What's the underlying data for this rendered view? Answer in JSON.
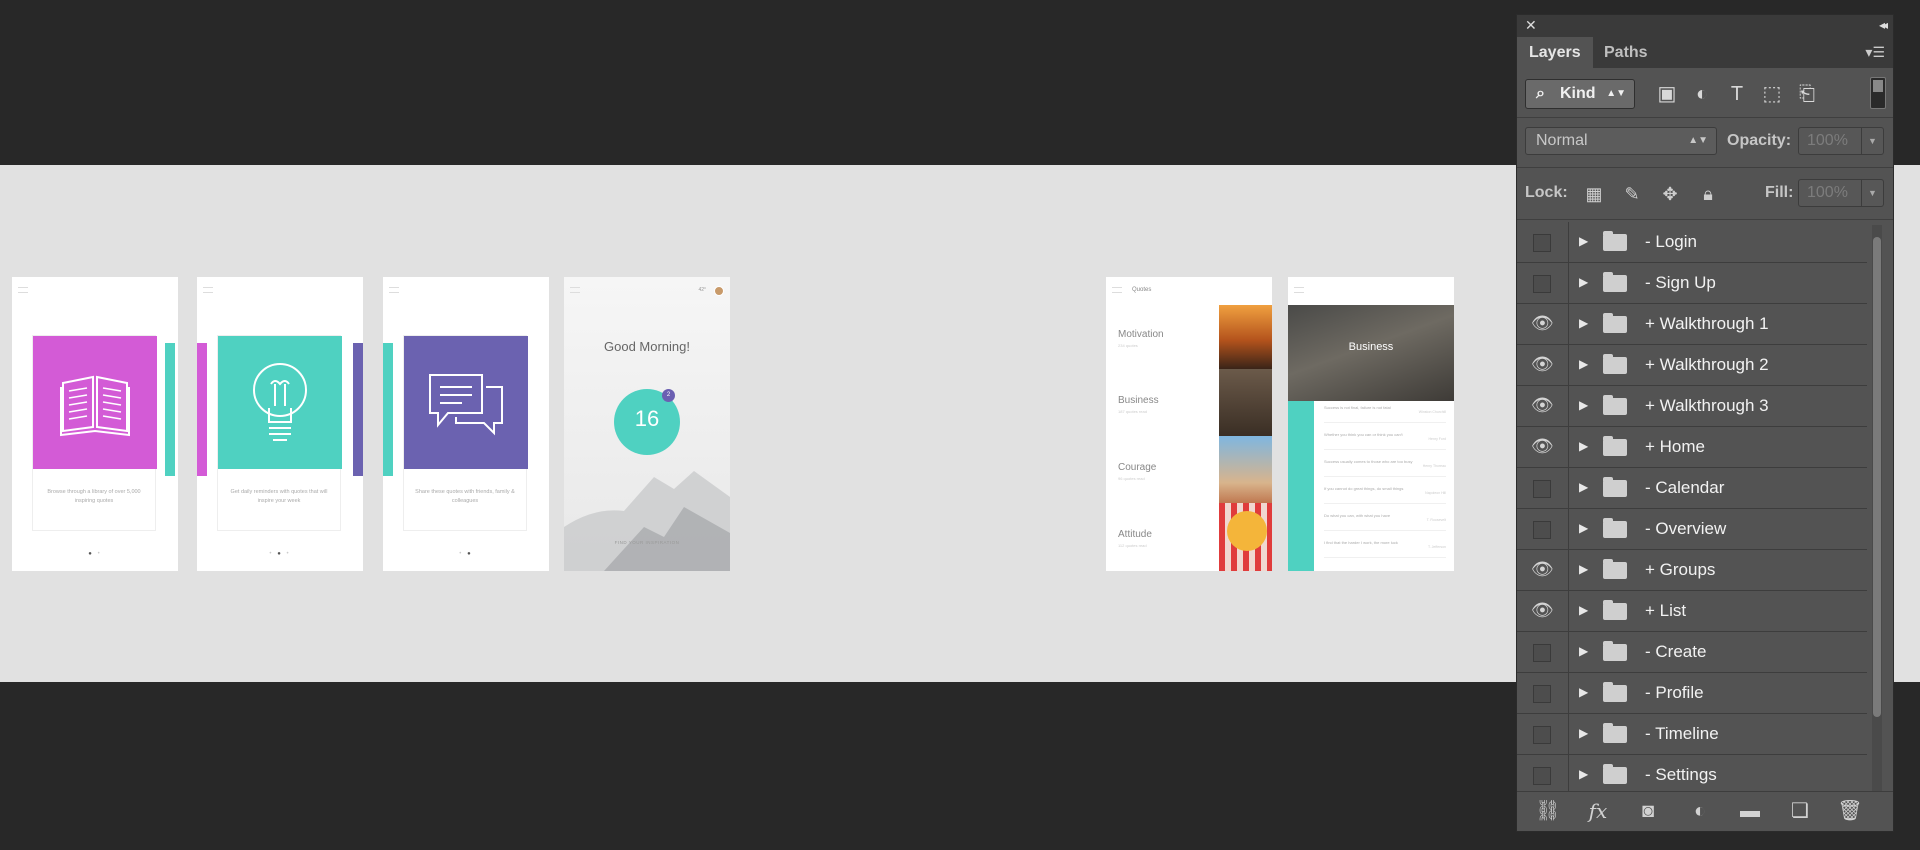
{
  "canvas": {
    "walkthrough1": {
      "text": "Browse through a library of over 5,000 inspiring quotes",
      "dots": [
        "●",
        "•"
      ]
    },
    "walkthrough2": {
      "text": "Get daily reminders with quotes that will inspire your week",
      "dots": [
        "•",
        "●",
        "•"
      ]
    },
    "walkthrough3": {
      "text": "Share these quotes with friends, family & colleagues",
      "dots": [
        "•",
        "●"
      ]
    },
    "home": {
      "title": "Good Morning!",
      "count": "16",
      "badge": "2",
      "temp": "42°",
      "hint": "FIND YOUR INSPIRATION"
    },
    "list": {
      "title": "Quotes",
      "items": [
        {
          "label": "Motivation",
          "sub": "234 quotes"
        },
        {
          "label": "Business",
          "sub": "187 quotes read"
        },
        {
          "label": "Courage",
          "sub": "96 quotes read"
        },
        {
          "label": "Attitude",
          "sub": "112 quotes read"
        }
      ]
    },
    "groups": {
      "title": "Business",
      "rows": [
        {
          "line": "Success is not final, failure is not fatal",
          "meta": "Winston Churchill"
        },
        {
          "line": "Whether you think you can or think you can't",
          "meta": "Henry Ford"
        },
        {
          "line": "Success usually comes to those who are too busy",
          "meta": "Henry Thoreau"
        },
        {
          "line": "If you cannot do great things, do small things",
          "meta": "Napoleon Hill"
        },
        {
          "line": "Do what you can, with what you have",
          "meta": "T. Roosevelt"
        },
        {
          "line": "I find that the harder I work, the more luck",
          "meta": "T. Jefferson"
        }
      ]
    }
  },
  "panel": {
    "close": "✕",
    "collapse": "◂◂",
    "tabs": [
      "Layers",
      "Paths"
    ],
    "filter": {
      "label": "Kind",
      "icons": [
        "image-filter-icon",
        "adjustment-filter-icon",
        "type-filter-icon",
        "shape-filter-icon",
        "smart-object-filter-icon"
      ]
    },
    "blend_mode": "Normal",
    "opacity_label": "Opacity:",
    "opacity_value": "100%",
    "lock_label": "Lock:",
    "fill_label": "Fill:",
    "fill_value": "100%",
    "layers": [
      {
        "name": "- Login",
        "visible": false
      },
      {
        "name": "- Sign Up",
        "visible": false
      },
      {
        "name": "+ Walkthrough 1",
        "visible": true
      },
      {
        "name": "+ Walkthrough 2",
        "visible": true
      },
      {
        "name": "+ Walkthrough 3",
        "visible": true
      },
      {
        "name": "+ Home",
        "visible": true
      },
      {
        "name": "- Calendar",
        "visible": false
      },
      {
        "name": "- Overview",
        "visible": false
      },
      {
        "name": "+ Groups",
        "visible": true
      },
      {
        "name": "+ List",
        "visible": true
      },
      {
        "name": "- Create",
        "visible": false
      },
      {
        "name": "- Profile",
        "visible": false
      },
      {
        "name": "- Timeline",
        "visible": false
      },
      {
        "name": "- Settings",
        "visible": false
      }
    ],
    "footer_icons": [
      "link-layers-icon",
      "fx-icon",
      "add-mask-icon",
      "adjustment-layer-icon",
      "new-group-icon",
      "new-layer-icon",
      "delete-layer-icon"
    ]
  },
  "colors": {
    "magenta": "#d35bd6",
    "teal": "#4fd1c1",
    "purple": "#6b62b0",
    "panel": "#535353",
    "canvas": "#e1e1e1"
  }
}
